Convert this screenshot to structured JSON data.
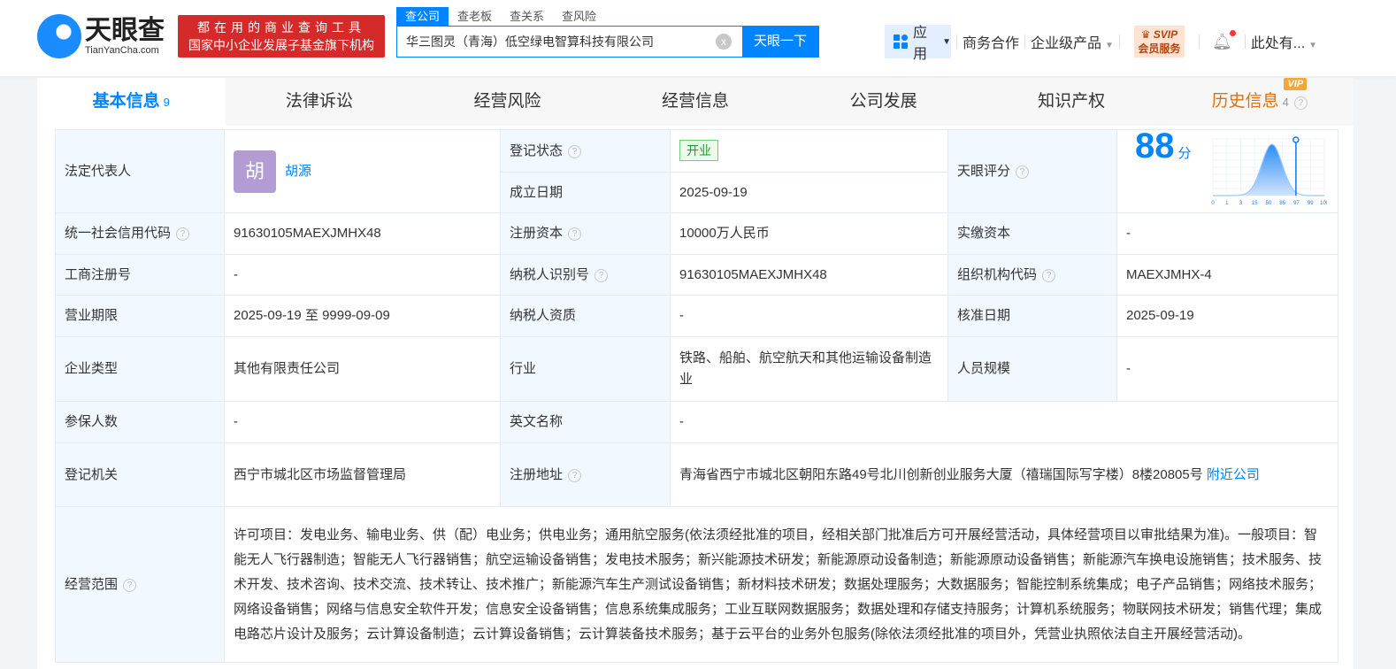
{
  "header": {
    "logo": "天眼查",
    "logo_sub": "TianYanCha.com",
    "slogan1": "都在用的商业查询工具",
    "slogan2": "国家中小企业发展子基金旗下机构",
    "search_tabs": [
      "查公司",
      "查老板",
      "查关系",
      "查风险"
    ],
    "search_value": "华三图灵（青海）低空绿电智算科技有限公司",
    "clear": "x",
    "search_button": "天眼一下",
    "nav": {
      "app": "应用",
      "business": "商务合作",
      "enterprise": "企业级产品",
      "svip": "SVIP",
      "svip_sub": "会员服务",
      "user": "此处有..."
    }
  },
  "tabs": [
    {
      "label": "基本信息",
      "count": "9"
    },
    {
      "label": "法律诉讼"
    },
    {
      "label": "经营风险"
    },
    {
      "label": "经营信息"
    },
    {
      "label": "公司发展"
    },
    {
      "label": "知识产权"
    },
    {
      "label": "历史信息",
      "count": "4",
      "vip": "VIP"
    }
  ],
  "info": {
    "legal_rep_label": "法定代表人",
    "legal_rep_avatar": "胡",
    "legal_rep": "胡源",
    "status_label": "登记状态",
    "status": "开业",
    "founded_label": "成立日期",
    "founded": "2025-09-19",
    "score_label": "天眼评分",
    "score": "88",
    "score_unit": "分",
    "score_chart": {
      "ticks": [
        "0",
        "1",
        "3",
        "15",
        "50",
        "85",
        "97",
        "99",
        "100"
      ],
      "marker_percentile": 85
    },
    "credit_code_label": "统一社会信用代码",
    "credit_code": "91630105MAEXJMHX48",
    "capital_label": "注册资本",
    "capital": "10000万人民币",
    "paid_label": "实缴资本",
    "paid": "-",
    "reg_no_label": "工商注册号",
    "reg_no": "-",
    "tax_id_label": "纳税人识别号",
    "tax_id": "91630105MAEXJMHX48",
    "org_code_label": "组织机构代码",
    "org_code": "MAEXJMHX-4",
    "term_label": "营业期限",
    "term": "2025-09-19 至 9999-09-09",
    "tax_qual_label": "纳税人资质",
    "tax_qual": "-",
    "approve_label": "核准日期",
    "approve": "2025-09-19",
    "type_label": "企业类型",
    "type": "其他有限责任公司",
    "industry_label": "行业",
    "industry": "铁路、船舶、航空航天和其他运输设备制造业",
    "staff_label": "人员规模",
    "staff": "-",
    "insured_label": "参保人数",
    "insured": "-",
    "en_name_label": "英文名称",
    "en_name": "-",
    "authority_label": "登记机关",
    "authority": "西宁市城北区市场监督管理局",
    "address_label": "注册地址",
    "address": "青海省西宁市城北区朝阳东路49号北川创新创业服务大厦（禧瑞国际写字楼）8楼20805号",
    "nearby": "附近公司",
    "scope_label": "经营范围",
    "scope": "许可项目：发电业务、输电业务、供（配）电业务；供电业务；通用航空服务(依法须经批准的项目，经相关部门批准后方可开展经营活动，具体经营项目以审批结果为准)。一般项目：智能无人飞行器制造；智能无人飞行器销售；航空运输设备销售；发电技术服务；新兴能源技术研发；新能源原动设备制造；新能源原动设备销售；新能源汽车换电设施销售；技术服务、技术开发、技术咨询、技术交流、技术转让、技术推广；新能源汽车生产测试设备销售；新材料技术研发；数据处理服务；大数据服务；智能控制系统集成；电子产品销售；网络技术服务；网络设备销售；网络与信息安全软件开发；信息安全设备销售；信息系统集成服务；工业互联网数据服务；数据处理和存储支持服务；计算机系统服务；物联网技术研发；销售代理；集成电路芯片设计及服务；云计算设备制造；云计算设备销售；云计算装备技术服务；基于云平台的业务外包服务(除依法须经批准的项目外，凭营业执照依法自主开展经营活动)。"
  }
}
